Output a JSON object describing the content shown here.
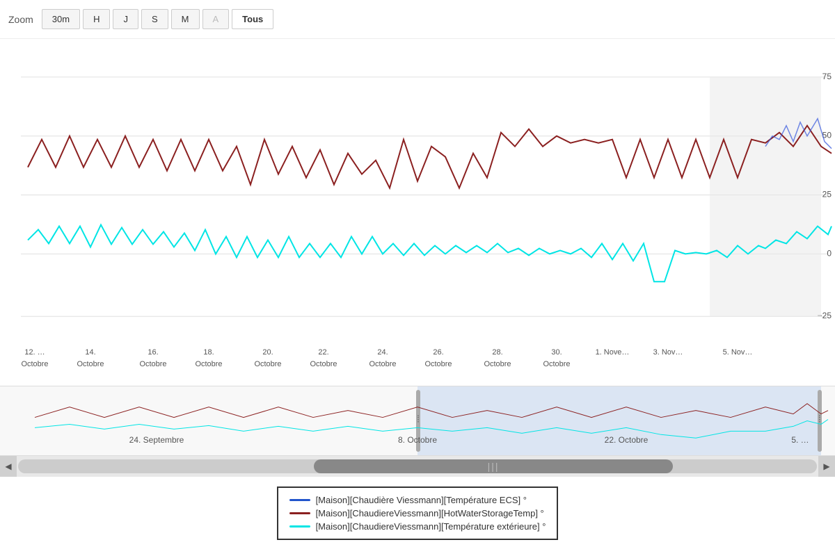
{
  "toolbar": {
    "label": "Zoom",
    "buttons": [
      {
        "id": "30m",
        "label": "30m",
        "active": false,
        "disabled": false
      },
      {
        "id": "H",
        "label": "H",
        "active": false,
        "disabled": false
      },
      {
        "id": "J",
        "label": "J",
        "active": false,
        "disabled": false
      },
      {
        "id": "S",
        "label": "S",
        "active": false,
        "disabled": false
      },
      {
        "id": "M",
        "label": "M",
        "active": false,
        "disabled": false
      },
      {
        "id": "A",
        "label": "A",
        "active": false,
        "disabled": true
      },
      {
        "id": "Tous",
        "label": "Tous",
        "active": true,
        "disabled": false
      }
    ]
  },
  "chart": {
    "yAxis": {
      "values": [
        "75",
        "50",
        "25",
        "0",
        "-25"
      ]
    },
    "xAxis": {
      "labels": [
        {
          "date": "12. …",
          "month": "Octobre"
        },
        {
          "date": "14.",
          "month": "Octobre"
        },
        {
          "date": "16.",
          "month": "Octobre"
        },
        {
          "date": "18.",
          "month": "Octobre"
        },
        {
          "date": "20.",
          "month": "Octobre"
        },
        {
          "date": "22.",
          "month": "Octobre"
        },
        {
          "date": "24.",
          "month": "Octobre"
        },
        {
          "date": "26.",
          "month": "Octobre"
        },
        {
          "date": "28.",
          "month": "Octobre"
        },
        {
          "date": "30.",
          "month": "Octobre"
        },
        {
          "date": "1. Nove…",
          "month": ""
        },
        {
          "date": "3. Nov…",
          "month": ""
        },
        {
          "date": "5. Nov…",
          "month": ""
        }
      ]
    }
  },
  "navigator": {
    "labels": [
      "24. Septembre",
      "8. Octobre",
      "22. Octobre",
      "5. …"
    ]
  },
  "legend": {
    "items": [
      {
        "color": "#2255cc",
        "label": "[Maison][Chaudière Viessmann][Température ECS] °"
      },
      {
        "color": "#8b2020",
        "label": "[Maison][ChaudiereViessmann][HotWaterStorageTemp] °"
      },
      {
        "color": "#00e5e5",
        "label": "[Maison][ChaudiereViessmann][Température extérieure] °"
      }
    ]
  },
  "scrollbar": {
    "left_arrow": "◀",
    "right_arrow": "▶",
    "grip": "|||"
  }
}
